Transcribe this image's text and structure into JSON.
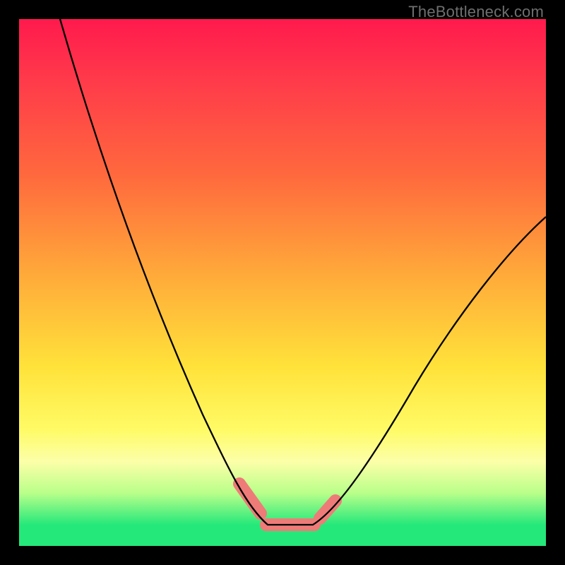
{
  "watermark": "TheBottleneck.com",
  "chart_data": {
    "type": "line",
    "title": "",
    "xlabel": "",
    "ylabel": "",
    "xlim": [
      0,
      100
    ],
    "ylim": [
      0,
      100
    ],
    "series": [
      {
        "name": "bottleneck-curve",
        "x": [
          8,
          12,
          16,
          20,
          24,
          28,
          32,
          36,
          40,
          43,
          46,
          49,
          52,
          55,
          58,
          62,
          66,
          72,
          78,
          86,
          94,
          100
        ],
        "y": [
          100,
          88,
          76,
          65,
          55,
          45,
          36,
          27,
          18,
          11,
          6,
          3,
          2,
          2,
          3,
          6,
          11,
          19,
          28,
          40,
          52,
          62
        ],
        "stroke": "#000000",
        "stroke_width": 2.3
      },
      {
        "name": "flat-highlight",
        "x": [
          43,
          46,
          49,
          52,
          55,
          58
        ],
        "y": [
          8,
          4,
          2.5,
          2.5,
          3.5,
          6
        ],
        "stroke": "#ef7b78",
        "stroke_width": 13
      }
    ],
    "highlight_segments": [
      {
        "x": [
          41.5,
          45.5
        ],
        "y": [
          11,
          5
        ],
        "label": "left-ramp"
      },
      {
        "x": [
          46.5,
          55.5
        ],
        "y": [
          3,
          3
        ],
        "label": "flat-bottom"
      },
      {
        "x": [
          56.5,
          59.5
        ],
        "y": [
          4.5,
          7.5
        ],
        "label": "right-ramp"
      }
    ]
  }
}
